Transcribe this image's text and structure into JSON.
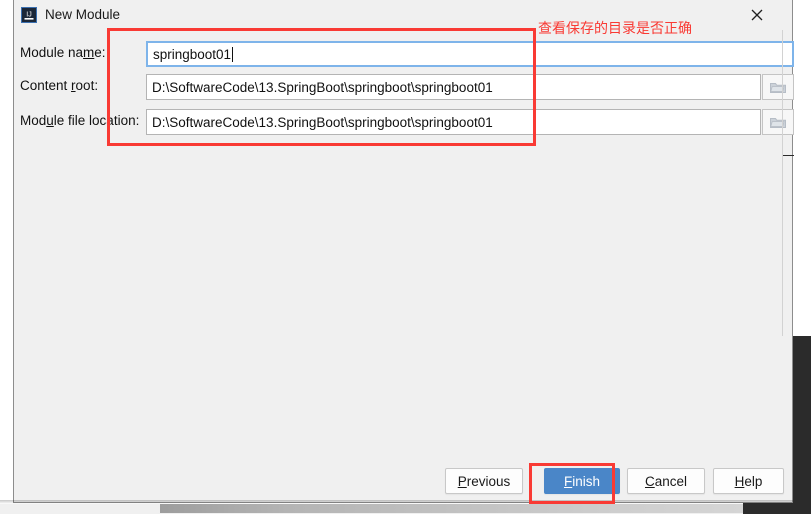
{
  "window": {
    "title": "New Module",
    "icon": "intellij-idea-icon",
    "close_label": "×"
  },
  "form": {
    "fields": [
      {
        "label_prefix": "Module na",
        "label_mnemonic": "m",
        "label_suffix": "e:",
        "label_full": "Module name:",
        "value": "springboot01",
        "focused": true,
        "has_browse": false
      },
      {
        "label_prefix": "Content ",
        "label_mnemonic": "r",
        "label_suffix": "oot:",
        "label_full": "Content root:",
        "value": "D:\\SoftwareCode\\13.SpringBoot\\springboot\\springboot01",
        "focused": false,
        "has_browse": true,
        "browse_icon": "folder-icon"
      },
      {
        "label_prefix": "Mod",
        "label_mnemonic": "u",
        "label_suffix": "le file location:",
        "label_full": "Module file location:",
        "value": "D:\\SoftwareCode\\13.SpringBoot\\springboot\\springboot01",
        "focused": false,
        "has_browse": true,
        "browse_icon": "folder-icon"
      }
    ]
  },
  "buttons": {
    "previous": {
      "prefix": "",
      "mnemonic": "P",
      "suffix": "revious",
      "full": "Previous"
    },
    "finish": {
      "prefix": "",
      "mnemonic": "F",
      "suffix": "inish",
      "full": "Finish",
      "primary": true
    },
    "cancel": {
      "prefix": "",
      "mnemonic": "C",
      "suffix": "ancel",
      "full": "Cancel"
    },
    "help": {
      "prefix": "",
      "mnemonic": "H",
      "suffix": "elp",
      "full": "Help"
    }
  },
  "annotations": {
    "note_text": "查看保存的目录是否正确",
    "color": "#f93a34"
  },
  "colors": {
    "dialog_bg": "#f0f0f0",
    "focus_border": "#7eb4ea",
    "primary_button": "#4a86c8",
    "annotation_red": "#f93a34",
    "editor_dark": "#2b2b2b"
  }
}
